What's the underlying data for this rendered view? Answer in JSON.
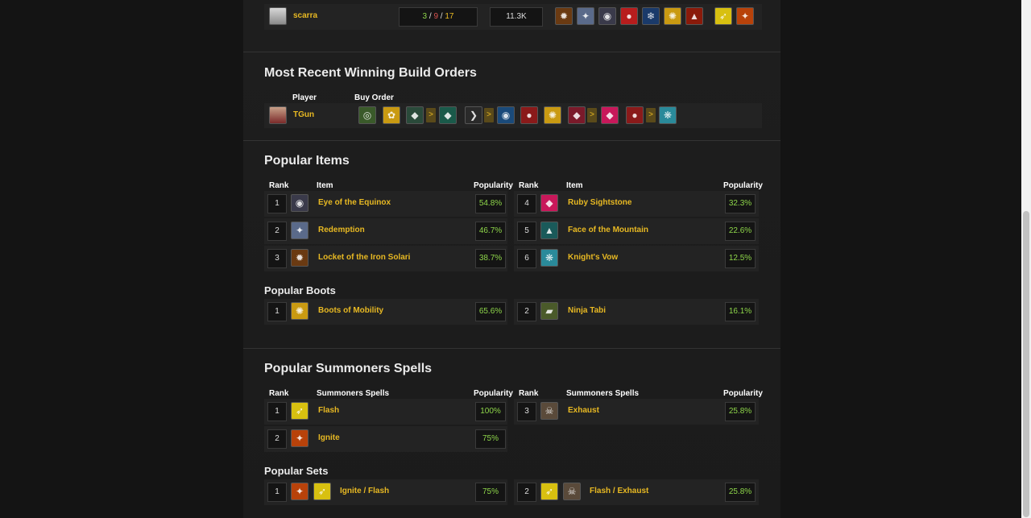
{
  "top_match": {
    "player": "scarra",
    "kda_kills": "3",
    "kda_deaths": "9",
    "kda_assists": "17",
    "kda_sep": "/",
    "gold": "11.3K",
    "item_icons": [
      "locket-icon",
      "redemption-icon",
      "eye-equinox-icon",
      "ruby-icon",
      "knights-vow-icon",
      "boots-mobility-icon",
      "volcano-icon"
    ],
    "spell_icons": [
      "flash-icon",
      "ignite-icon"
    ]
  },
  "build_orders": {
    "title": "Most Recent Winning Build Orders",
    "col_player": "Player",
    "col_buy_order": "Buy Order",
    "player": "TGun",
    "arrow": ">"
  },
  "popular_items": {
    "title": "Popular Items",
    "col_rank": "Rank",
    "col_item": "Item",
    "col_popularity": "Popularity",
    "left": [
      {
        "rank": "1",
        "name": "Eye of the Equinox",
        "pct": "54.8%"
      },
      {
        "rank": "2",
        "name": "Redemption",
        "pct": "46.7%"
      },
      {
        "rank": "3",
        "name": "Locket of the Iron Solari",
        "pct": "38.7%"
      }
    ],
    "right": [
      {
        "rank": "4",
        "name": "Ruby Sightstone",
        "pct": "32.3%"
      },
      {
        "rank": "5",
        "name": "Face of the Mountain",
        "pct": "22.6%"
      },
      {
        "rank": "6",
        "name": "Knight's Vow",
        "pct": "12.5%"
      }
    ]
  },
  "popular_boots": {
    "title": "Popular Boots",
    "items": [
      {
        "rank": "1",
        "name": "Boots of Mobility",
        "pct": "65.6%"
      },
      {
        "rank": "2",
        "name": "Ninja Tabi",
        "pct": "16.1%"
      }
    ]
  },
  "popular_spells": {
    "title": "Popular Summoners Spells",
    "col_rank": "Rank",
    "col_spells": "Summoners Spells",
    "col_popularity": "Popularity",
    "left": [
      {
        "rank": "1",
        "name": "Flash",
        "pct": "100%"
      },
      {
        "rank": "2",
        "name": "Ignite",
        "pct": "75%"
      }
    ],
    "right": [
      {
        "rank": "3",
        "name": "Exhaust",
        "pct": "25.8%"
      }
    ]
  },
  "popular_sets": {
    "title": "Popular Sets",
    "items": [
      {
        "rank": "1",
        "name": "Ignite / Flash",
        "pct": "75%"
      },
      {
        "rank": "2",
        "name": "Flash / Exhaust",
        "pct": "25.8%"
      }
    ]
  }
}
